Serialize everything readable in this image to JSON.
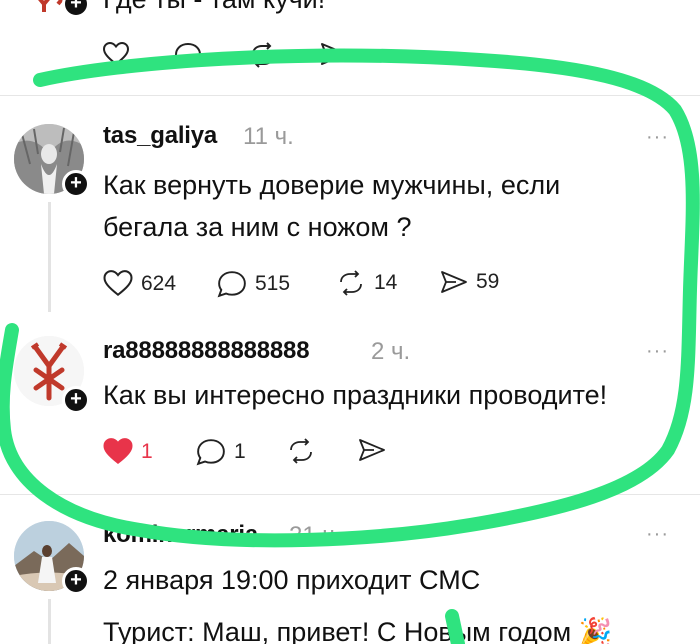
{
  "post_top": {
    "text": "Где ты - там кучи!"
  },
  "post1": {
    "username": "tas_galiya",
    "time": "11 ч.",
    "text_line1": "Как вернуть доверие мужчины, если",
    "text_line2": "бегала за ним с ножом ?",
    "likes": "624",
    "comments": "515",
    "reposts": "14",
    "shares": "59"
  },
  "post2": {
    "username": "ra88888888888888",
    "time": "2 ч.",
    "text": "Как вы интересно праздники проводите!",
    "likes": "1",
    "comments": "1"
  },
  "post3": {
    "username": "kominarmaria",
    "time": "21 ч.",
    "text_line1": "2 января 19:00 приходит СМС",
    "text_line2": "Турист: Маш, привет! С Новым годом 🎉"
  },
  "ui": {
    "more_label": "···",
    "plus_label": "+"
  },
  "colors": {
    "highlight_green": "#2fe37f",
    "liked_red": "#e8344a"
  }
}
